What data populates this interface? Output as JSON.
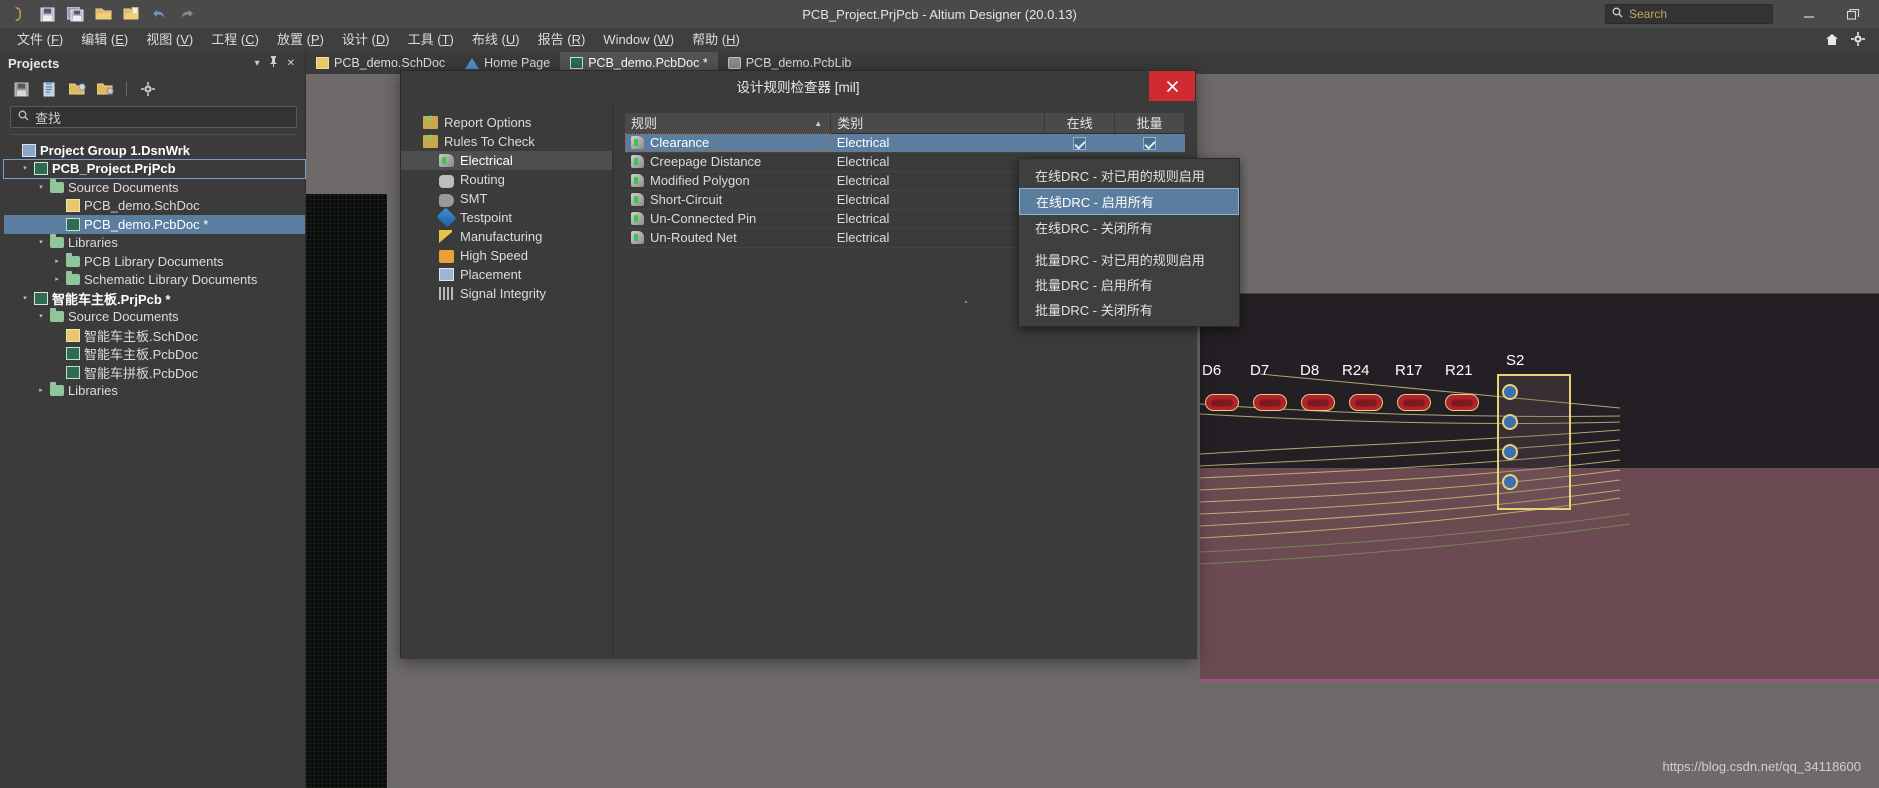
{
  "window": {
    "title": "PCB_Project.PrjPcb - Altium Designer (20.0.13)",
    "search_placeholder": "Search",
    "minimize_label": "–",
    "restore_label": "❐",
    "quick_access": [
      {
        "name": "altium-logo-icon",
        "glyph": "∂"
      },
      {
        "name": "save-icon",
        "glyph": "💾"
      },
      {
        "name": "save-all-icon",
        "glyph": "💾"
      },
      {
        "name": "open-icon",
        "glyph": "📂"
      },
      {
        "name": "open-project-icon",
        "glyph": "📁"
      },
      {
        "name": "undo-icon",
        "glyph": "↶"
      },
      {
        "name": "redo-icon",
        "glyph": "↷"
      }
    ]
  },
  "menubar": {
    "items": [
      {
        "label": "文件",
        "accel": "F"
      },
      {
        "label": "编辑",
        "accel": "E"
      },
      {
        "label": "视图",
        "accel": "V"
      },
      {
        "label": "工程",
        "accel": "C"
      },
      {
        "label": "放置",
        "accel": "P"
      },
      {
        "label": "设计",
        "accel": "D"
      },
      {
        "label": "工具",
        "accel": "T"
      },
      {
        "label": "布线",
        "accel": "U"
      },
      {
        "label": "报告",
        "accel": "R"
      },
      {
        "label": "Window",
        "accel": "W"
      },
      {
        "label": "帮助",
        "accel": "H"
      }
    ],
    "right_icons": [
      {
        "name": "home-icon",
        "glyph": "⌂"
      },
      {
        "name": "settings-gear-icon",
        "glyph": "⚙"
      }
    ]
  },
  "projects_panel": {
    "title": "Projects",
    "header_buttons": [
      {
        "name": "panel-dropdown-icon",
        "glyph": "▾"
      },
      {
        "name": "panel-pin-icon",
        "glyph": "⚓"
      },
      {
        "name": "panel-close-icon",
        "glyph": "✕"
      }
    ],
    "toolbar": [
      {
        "name": "save-project-icon",
        "glyph": "💾"
      },
      {
        "name": "compile-project-icon",
        "glyph": "📋"
      },
      {
        "name": "open-project-icon",
        "glyph": "📂"
      },
      {
        "name": "project-options-icon",
        "glyph": "📁"
      },
      {
        "name": "panel-settings-icon",
        "glyph": "⚙"
      }
    ],
    "search_placeholder": "查找",
    "tree": [
      {
        "label": "Project Group 1.DsnWrk",
        "indent": 0,
        "arrow": "blank",
        "icon": "ic-wrk",
        "style": "bold",
        "state": "none"
      },
      {
        "label": "PCB_Project.PrjPcb",
        "indent": 1,
        "arrow": "down",
        "icon": "ic-prj",
        "style": "bold",
        "state": "sel-box"
      },
      {
        "label": "Source Documents",
        "indent": 2,
        "arrow": "down",
        "icon": "ic-fold",
        "style": "",
        "state": "none"
      },
      {
        "label": "PCB_demo.SchDoc",
        "indent": 3,
        "arrow": "blank",
        "icon": "ic-sch",
        "style": "",
        "state": "none"
      },
      {
        "label": "PCB_demo.PcbDoc *",
        "indent": 3,
        "arrow": "blank",
        "icon": "ic-pcb",
        "style": "",
        "state": "sel-fill"
      },
      {
        "label": "Libraries",
        "indent": 2,
        "arrow": "down",
        "icon": "ic-fold",
        "style": "",
        "state": "none"
      },
      {
        "label": "PCB Library Documents",
        "indent": 3,
        "arrow": "right",
        "icon": "ic-fold",
        "style": "",
        "state": "none"
      },
      {
        "label": "Schematic Library Documents",
        "indent": 3,
        "arrow": "right",
        "icon": "ic-fold",
        "style": "",
        "state": "none"
      },
      {
        "label": "智能车主板.PrjPcb *",
        "indent": 1,
        "arrow": "down",
        "icon": "ic-prj",
        "style": "bold",
        "state": "none"
      },
      {
        "label": "Source Documents",
        "indent": 2,
        "arrow": "down",
        "icon": "ic-fold",
        "style": "",
        "state": "none"
      },
      {
        "label": "智能车主板.SchDoc",
        "indent": 3,
        "arrow": "blank",
        "icon": "ic-sch",
        "style": "",
        "state": "none"
      },
      {
        "label": "智能车主板.PcbDoc",
        "indent": 3,
        "arrow": "blank",
        "icon": "ic-pcb",
        "style": "",
        "state": "none"
      },
      {
        "label": "智能车拼板.PcbDoc",
        "indent": 3,
        "arrow": "blank",
        "icon": "ic-pcb",
        "style": "",
        "state": "none"
      },
      {
        "label": "Libraries",
        "indent": 2,
        "arrow": "right",
        "icon": "ic-fold",
        "style": "",
        "state": "none"
      }
    ]
  },
  "document_tabs": [
    {
      "label": "PCB_demo.SchDoc",
      "icon": "ti-sch",
      "active": false
    },
    {
      "label": "Home Page",
      "icon": "ti-home",
      "active": false
    },
    {
      "label": "PCB_demo.PcbDoc *",
      "icon": "ti-pcb",
      "active": true
    },
    {
      "label": "PCB_demo.PcbLib",
      "icon": "ti-lib",
      "active": false
    }
  ],
  "dialog": {
    "title": "设计规则检查器 [mil]",
    "close_label": "✕",
    "tree": [
      {
        "label": "Report Options",
        "icon": "ic-rep",
        "child": false,
        "selected": false
      },
      {
        "label": "Rules To Check",
        "icon": "ic-rep",
        "child": false,
        "selected": false
      },
      {
        "label": "Electrical",
        "icon": "ic-elec",
        "child": true,
        "selected": true
      },
      {
        "label": "Routing",
        "icon": "ic-rout",
        "child": true,
        "selected": false
      },
      {
        "label": "SMT",
        "icon": "ic-smt",
        "child": true,
        "selected": false
      },
      {
        "label": "Testpoint",
        "icon": "ic-test",
        "child": true,
        "selected": false
      },
      {
        "label": "Manufacturing",
        "icon": "ic-manu",
        "child": true,
        "selected": false
      },
      {
        "label": "High Speed",
        "icon": "ic-hs",
        "child": true,
        "selected": false
      },
      {
        "label": "Placement",
        "icon": "ic-plac",
        "child": true,
        "selected": false
      },
      {
        "label": "Signal Integrity",
        "icon": "ic-sig",
        "child": true,
        "selected": false
      }
    ],
    "table": {
      "columns": [
        "规则",
        "类别",
        "在线",
        "批量"
      ],
      "sort_indicator": "▲",
      "rows": [
        {
          "rule": "Clearance",
          "category": "Electrical",
          "online": true,
          "batch": true,
          "selected": true
        },
        {
          "rule": "Creepage Distance",
          "category": "Electrical",
          "online": false,
          "batch": false,
          "selected": false
        },
        {
          "rule": "Modified Polygon",
          "category": "Electrical",
          "online": false,
          "batch": false,
          "selected": false
        },
        {
          "rule": "Short-Circuit",
          "category": "Electrical",
          "online": false,
          "batch": false,
          "selected": false
        },
        {
          "rule": "Un-Connected Pin",
          "category": "Electrical",
          "online": false,
          "batch": false,
          "selected": false
        },
        {
          "rule": "Un-Routed Net",
          "category": "Electrical",
          "online": false,
          "batch": false,
          "selected": false
        }
      ]
    }
  },
  "context_menu": {
    "items": [
      {
        "label": "在线DRC - 对已用的规则启用",
        "highlighted": false,
        "separator_after": false
      },
      {
        "label": "在线DRC - 启用所有",
        "highlighted": true,
        "separator_after": false
      },
      {
        "label": "在线DRC - 关闭所有",
        "highlighted": false,
        "separator_after": true
      },
      {
        "label": "批量DRC - 对已用的规则启用",
        "highlighted": false,
        "separator_after": false
      },
      {
        "label": "批量DRC - 启用所有",
        "highlighted": false,
        "separator_after": false
      },
      {
        "label": "批量DRC - 关闭所有",
        "highlighted": false,
        "separator_after": false
      }
    ]
  },
  "pcb_canvas": {
    "designators": [
      "D6",
      "D7",
      "D8",
      "R24",
      "R17",
      "R21",
      "S2"
    ],
    "watermark": "https://blog.csdn.net/qq_34118600"
  }
}
